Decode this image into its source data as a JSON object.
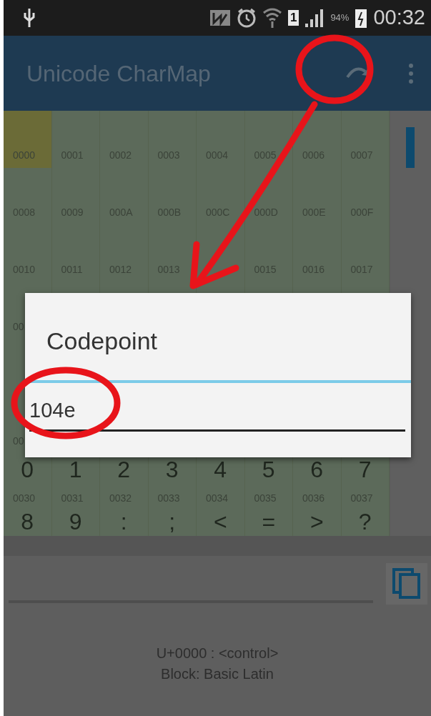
{
  "status_bar": {
    "sim": "1",
    "battery_text": "94%",
    "time": "00:32"
  },
  "app_bar": {
    "title": "Unicode CharMap"
  },
  "grid": {
    "rows": [
      {
        "cells": [
          {
            "code": "0000",
            "selected": true
          },
          {
            "code": "0001",
            "selected": false
          },
          {
            "code": "0002",
            "selected": false
          },
          {
            "code": "0003",
            "selected": false
          },
          {
            "code": "0004",
            "selected": false
          },
          {
            "code": "0005",
            "selected": false
          },
          {
            "code": "0006",
            "selected": false
          },
          {
            "code": "0007",
            "selected": false
          }
        ]
      },
      {
        "cells": [
          {
            "code": "0008",
            "selected": false
          },
          {
            "code": "0009",
            "selected": false
          },
          {
            "code": "000A",
            "selected": false
          },
          {
            "code": "000B",
            "selected": false
          },
          {
            "code": "000C",
            "selected": false
          },
          {
            "code": "000D",
            "selected": false
          },
          {
            "code": "000E",
            "selected": false
          },
          {
            "code": "000F",
            "selected": false
          }
        ]
      },
      {
        "cells": [
          {
            "code": "0010",
            "selected": false
          },
          {
            "code": "0011",
            "selected": false
          },
          {
            "code": "0012",
            "selected": false
          },
          {
            "code": "0013",
            "selected": false
          },
          {
            "selected": false
          },
          {
            "code": "0015",
            "selected": false
          },
          {
            "code": "0016",
            "selected": false
          },
          {
            "code": "0017",
            "selected": false
          }
        ]
      },
      {
        "cells": [
          {
            "code": "00",
            "selected": false
          }
        ]
      },
      {
        "cells": [
          {
            "code": "00",
            "selected": false
          }
        ]
      },
      {
        "cells": [
          {
            "glyph": "0",
            "code": "0030",
            "selected": false
          },
          {
            "glyph": "1",
            "code": "0031",
            "selected": false
          },
          {
            "glyph": "2",
            "code": "0032",
            "selected": false
          },
          {
            "glyph": "3",
            "code": "0033",
            "selected": false
          },
          {
            "glyph": "4",
            "code": "0034",
            "selected": false
          },
          {
            "glyph": "5",
            "code": "0035",
            "selected": false
          },
          {
            "glyph": "6",
            "code": "0036",
            "selected": false
          },
          {
            "glyph": "7",
            "code": "0037",
            "selected": false
          }
        ]
      },
      {
        "cells": [
          {
            "glyph": "8",
            "selected": false
          },
          {
            "glyph": "9",
            "selected": false
          },
          {
            "glyph": ":",
            "selected": false
          },
          {
            "glyph": ";",
            "selected": false
          },
          {
            "glyph": "<",
            "selected": false
          },
          {
            "glyph": "=",
            "selected": false
          },
          {
            "glyph": ">",
            "selected": false
          },
          {
            "glyph": "?",
            "selected": false
          }
        ]
      }
    ]
  },
  "dialog": {
    "title": "Codepoint",
    "value": "104e"
  },
  "info": {
    "line_1": "U+0000 : <control>",
    "line_2": "Block: Basic Latin"
  }
}
